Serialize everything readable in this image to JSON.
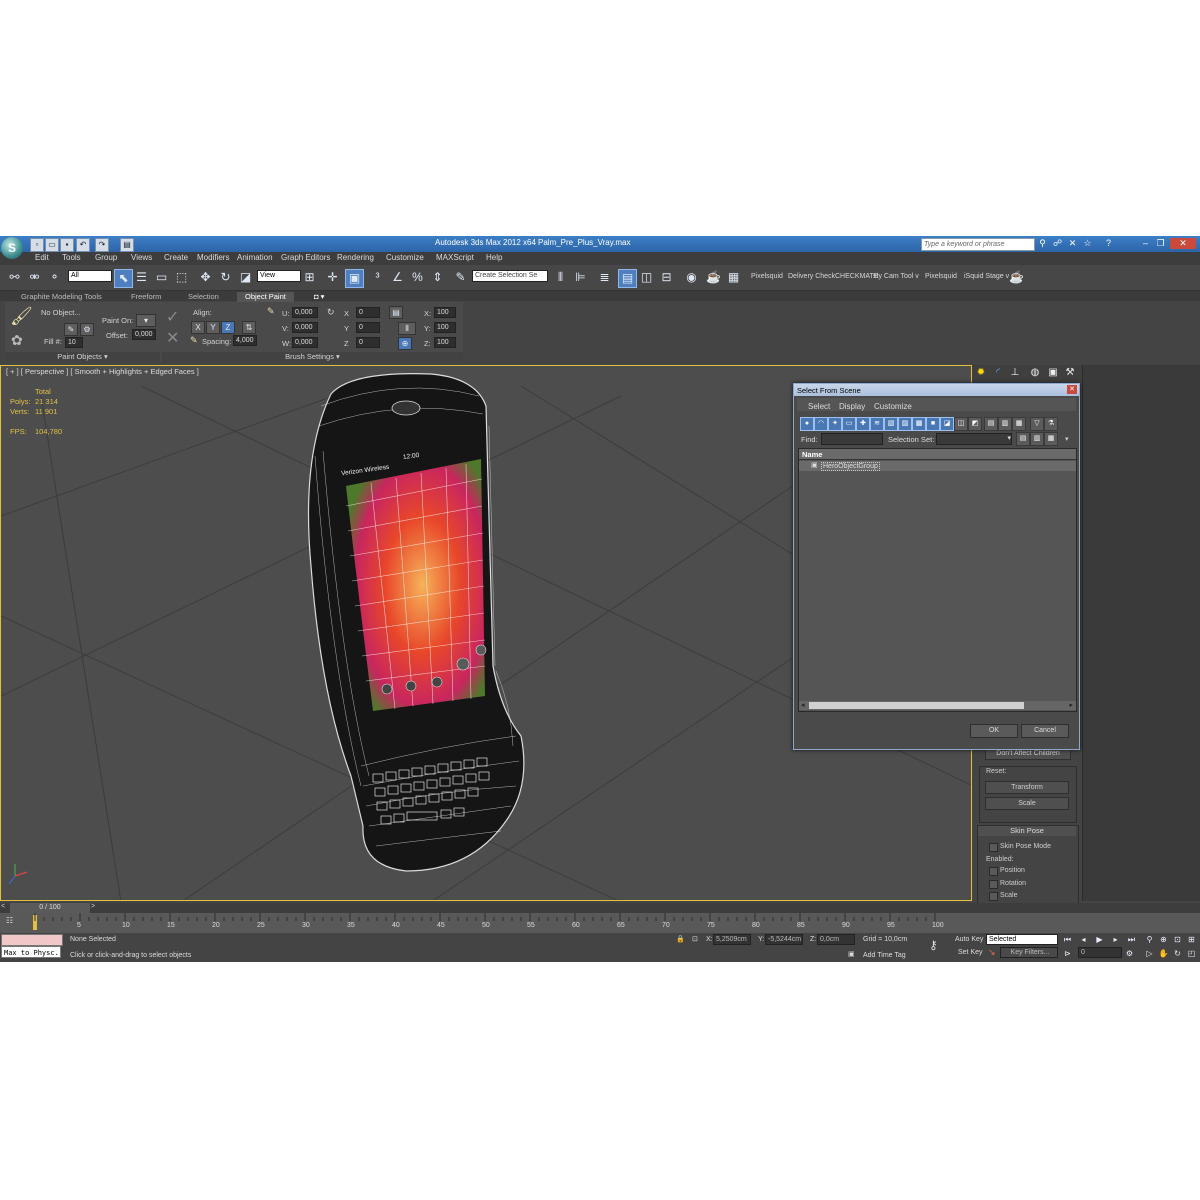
{
  "window": {
    "title": "Autodesk 3ds Max  2012 x64",
    "file": "Palm_Pre_Plus_Vray.max",
    "search_placeholder": "Type a keyword or phrase",
    "app_logo": "S"
  },
  "menu": [
    "Edit",
    "Tools",
    "Group",
    "Views",
    "Create",
    "Modifiers",
    "Animation",
    "Graph Editors",
    "Rendering",
    "Customize",
    "MAXScript",
    "Help"
  ],
  "toolbar": {
    "filter": "All",
    "coord": "View",
    "selection_set_placeholder": "Create Selection Se",
    "plugins": [
      "Pixelsquid",
      "Delivery Check",
      "CHECKMATE",
      "sty Cam Tool v",
      "Pixelsquid",
      "iSquid Stage v"
    ]
  },
  "ribbon": {
    "tabs": [
      "Graphite Modeling Tools",
      "Freeform",
      "Selection",
      "Object Paint"
    ],
    "active_tab": "Object Paint",
    "no_object": "No Object...",
    "paint_on": "Paint On:",
    "offset_label": "Offset:",
    "offset_value": "0,000",
    "fill_label": "Fill #:",
    "fill_value": "10",
    "align_label": "Align:",
    "axes": [
      "X",
      "Y",
      "Z"
    ],
    "spacing_label": "Spacing:",
    "spacing_value": "4,000",
    "u_label": "U:",
    "u_value": "0,000",
    "v_label": "V:",
    "v_value": "0,000",
    "w_label": "W:",
    "w_value": "0,000",
    "x_label": "X",
    "x_value": "0",
    "y_label": "Y",
    "y_value": "0",
    "z_label": "Z",
    "z_value": "0",
    "sx_label": "X:",
    "sx_value": "100",
    "sy_label": "Y:",
    "sy_value": "100",
    "sz_label": "Z:",
    "sz_value": "100",
    "footer_paint_objects": "Paint Objects",
    "footer_brush_settings": "Brush Settings"
  },
  "viewport": {
    "label": "[ + ] [ Perspective ] [ Smooth + Highlights + Edged Faces ]",
    "stats": {
      "total_label": "Total",
      "polys_label": "Polys:",
      "polys_value": "21 314",
      "verts_label": "Verts:",
      "verts_value": "11 901",
      "fps_label": "FPS:",
      "fps_value": "104,780"
    },
    "phone_carrier": "Verizon Wireless",
    "phone_time": "12:00"
  },
  "dialog": {
    "title": "Select From Scene",
    "menu": [
      "Select",
      "Display",
      "Customize"
    ],
    "find_label": "Find:",
    "selection_set_label": "Selection Set:",
    "column_name": "Name",
    "items": [
      "HeroObjectGroup"
    ],
    "ok": "OK",
    "cancel": "Cancel"
  },
  "command_panel": {
    "dont_affect_children": "Don't Affect Children",
    "reset_label": "Reset:",
    "transform": "Transform",
    "scale": "Scale",
    "skin_pose_title": "Skin Pose",
    "skin_pose_mode": "Skin Pose Mode",
    "enabled_label": "Enabled:",
    "position": "Position",
    "rotation": "Rotation",
    "scale_chk": "Scale"
  },
  "timeline": {
    "frame_display": "0 / 100",
    "ticks": [
      "5",
      "10",
      "15",
      "20",
      "25",
      "30",
      "35",
      "40",
      "45",
      "50",
      "55",
      "60",
      "65",
      "70",
      "75",
      "80",
      "85",
      "90",
      "95",
      "100"
    ]
  },
  "status": {
    "script_listener": "Max to Physc.",
    "selection": "None Selected",
    "prompt": "Click or click-and-drag to select objects",
    "x_label": "X:",
    "x_value": "5,2509cm",
    "y_label": "Y:",
    "y_value": "-5,5244cm",
    "z_label": "Z:",
    "z_value": "0,0cm",
    "grid": "Grid = 10,0cm",
    "add_time_tag": "Add Time Tag",
    "auto_key": "Auto Key",
    "set_key": "Set Key",
    "key_mode": "Selected",
    "key_filters": "Key Filters...",
    "frame_value": "0"
  },
  "colors": {
    "title_bar": "#2d64a8",
    "viewport_border": "#e2c142",
    "stats": "#e2c142",
    "ui_bg": "#444444"
  }
}
